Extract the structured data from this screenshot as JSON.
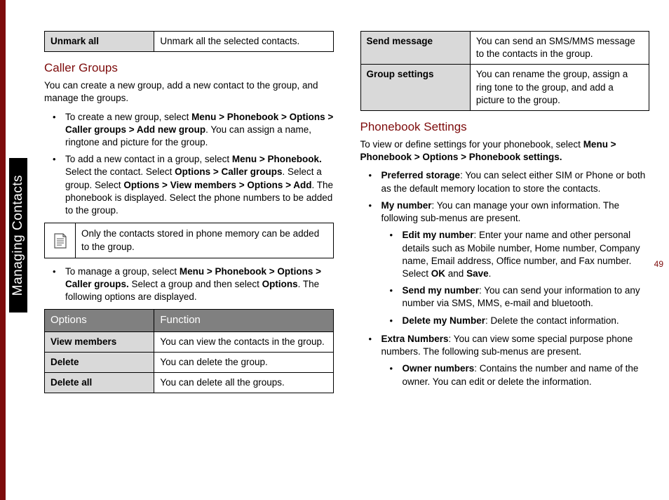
{
  "sideTab": "Managing Contacts",
  "pageNumber": "49",
  "col1": {
    "topTable": {
      "r1c1": "Unmark all",
      "r1c2": "Unmark all the selected contacts."
    },
    "h1": "Caller Groups",
    "p1": "You can create a new group, add a new contact to the group, and manage the groups.",
    "li1a": "To create a new group, select ",
    "li1b": "Menu > Phonebook > Options > Caller groups > Add new group",
    "li1c": ". You can assign a name, ringtone and picture for the group.",
    "li2a": "To add a new contact in a group, select ",
    "li2b": "Menu > Phonebook.",
    "li2c": " Select the contact. Select ",
    "li2d": "Options > Caller groups",
    "li2e": ". Select a group. Select ",
    "li2f": "Options > View members > Options > Add",
    "li2g": ". The phonebook is displayed. Select the phone numbers to be added to the group.",
    "note": "Only the contacts stored in phone memory can be added to the group.",
    "li3a": "To manage a group, select ",
    "li3b": "Menu > Phonebook > Options > Caller groups.",
    "li3c": " Select a group and then select ",
    "li3d": "Options",
    "li3e": ". The following options are displayed.",
    "tbl": {
      "h1": "Options",
      "h2": "Function",
      "r1c1": "View members",
      "r1c2": "You can view the contacts in the group.",
      "r2c1": "Delete",
      "r2c2": "You can delete the group.",
      "r3c1": "Delete all",
      "r3c2": "You can delete all the groups."
    }
  },
  "col2": {
    "topTable": {
      "r1c1": "Send message",
      "r1c2": "You can send an SMS/MMS message to the contacts in the group.",
      "r2c1": "Group settings",
      "r2c2": "You can rename the group, assign a ring tone to the group, and add a picture to the group."
    },
    "h1": "Phonebook Settings",
    "p1a": "To view or define settings for your phonebook, select ",
    "p1b": "Menu > Phonebook > Options > Phonebook settings.",
    "li1a": "Preferred storage",
    "li1b": ": You can select either SIM or Phone or both as the default memory location to store the contacts.",
    "li2a": "My number",
    "li2b": ": You can manage your own information. The following sub-menus are present.",
    "li2_1a": "Edit my number",
    "li2_1b": ": Enter your name and other personal details such as Mobile number, Home number, Company name, Email address, Office number, and Fax number. Select ",
    "li2_1c": "OK",
    "li2_1d": " and ",
    "li2_1e": "Save",
    "li2_1f": ".",
    "li2_2a": "Send my number",
    "li2_2b": ": You can send your information to any number via SMS, MMS, e-mail and bluetooth.",
    "li2_3a": "Delete my Number",
    "li2_3b": ": Delete the contact information.",
    "li3a": "Extra Numbers",
    "li3b": ": You can view some special purpose phone numbers. The following sub-menus are present.",
    "li3_1a": "Owner numbers",
    "li3_1b": ": Contains the number and name of the owner. You can edit or delete the information."
  }
}
